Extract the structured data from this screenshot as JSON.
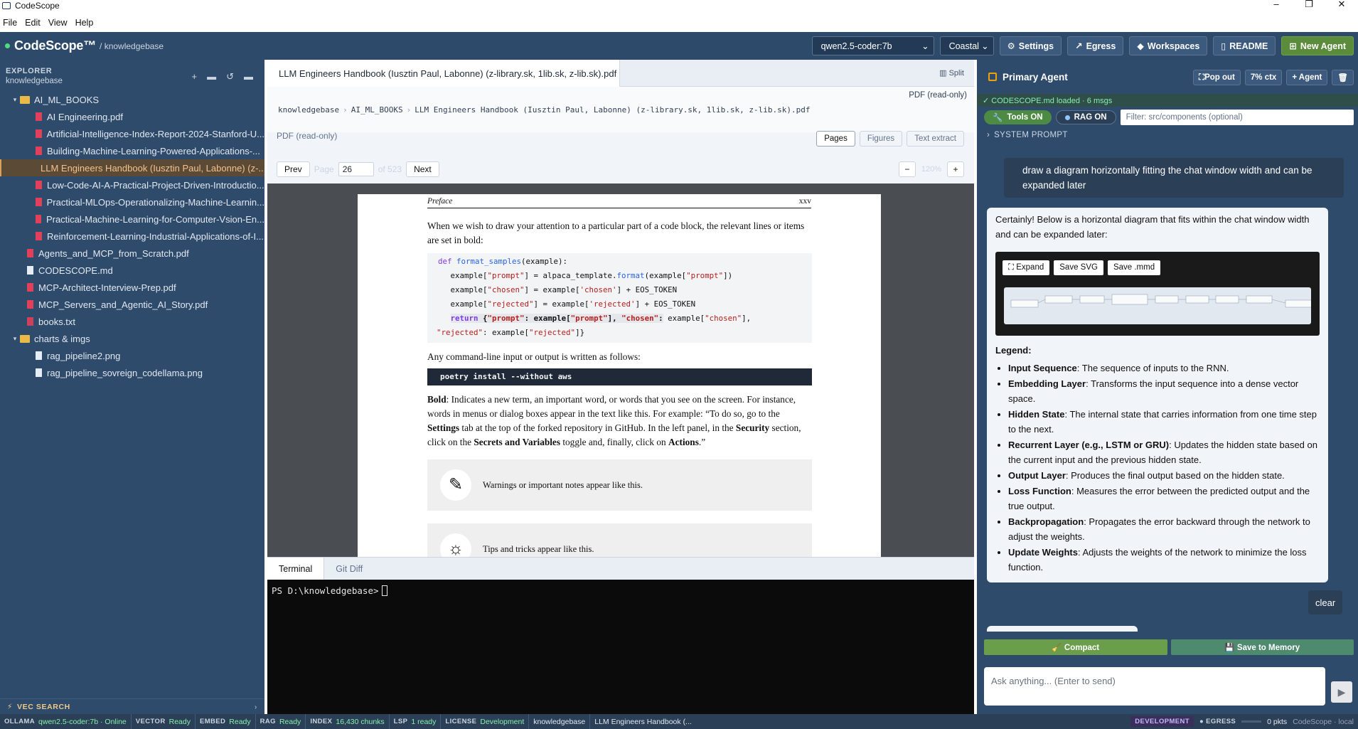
{
  "window": {
    "title": "CodeScope",
    "controls": [
      "–",
      "❐",
      "✕"
    ]
  },
  "menu": [
    "File",
    "Edit",
    "View",
    "Help"
  ],
  "header": {
    "brand": "CodeScope™",
    "path": "/ knowledgebase",
    "model_select": "qwen2.5-coder:7b",
    "theme_select": "Coastal",
    "buttons": {
      "settings": "Settings",
      "egress": "Egress",
      "workspaces": "Workspaces",
      "readme": "README",
      "new_agent": "New Agent"
    }
  },
  "sidebar": {
    "title": "EXPLORER",
    "subtitle": "knowledgebase",
    "items": [
      {
        "label": "AI_ML_BOOKS",
        "type": "folder",
        "level": 0,
        "twisty": "▾"
      },
      {
        "label": "AI Engineering.pdf",
        "type": "pdf",
        "level": 1
      },
      {
        "label": "Artificial-Intelligence-Index-Report-2024-Stanford-U...",
        "type": "pdf",
        "level": 1
      },
      {
        "label": "Building-Machine-Learning-Powered-Applications-...",
        "type": "pdf",
        "level": 1
      },
      {
        "label": "LLM Engineers Handbook (Iusztin Paul, Labonne) (z-...",
        "type": "pdf",
        "level": 1,
        "selected": true
      },
      {
        "label": "Low-Code-AI-A-Practical-Project-Driven-Introductio...",
        "type": "pdf",
        "level": 1
      },
      {
        "label": "Practical-MLOps-Operationalizing-Machine-Learnin...",
        "type": "pdf",
        "level": 1
      },
      {
        "label": "Practical-Machine-Learning-for-Computer-Vsion-En...",
        "type": "pdf",
        "level": 1
      },
      {
        "label": "Reinforcement-Learning-Industrial-Applications-of-I...",
        "type": "pdf",
        "level": 1
      },
      {
        "label": "Agents_and_MCP_from_Scratch.pdf",
        "type": "pdf",
        "level": 0
      },
      {
        "label": "CODESCOPE.md",
        "type": "md",
        "level": 0
      },
      {
        "label": "MCP-Architect-Interview-Prep.pdf",
        "type": "pdf",
        "level": 0
      },
      {
        "label": "MCP_Servers_and_Agentic_AI_Story.pdf",
        "type": "pdf",
        "level": 0
      },
      {
        "label": "books.txt",
        "type": "txt",
        "level": 0
      },
      {
        "label": "charts & imgs",
        "type": "folder",
        "level": 0,
        "twisty": "▾"
      },
      {
        "label": "rag_pipeline2.png",
        "type": "png",
        "level": 1
      },
      {
        "label": "rag_pipeline_sovreign_codellama.png",
        "type": "png",
        "level": 1
      }
    ],
    "vec_search": "VEC SEARCH"
  },
  "editor": {
    "tab_label": "LLM Engineers Handbook (Iusztin Paul, Labonne) (z-library.sk, 1lib.sk, z-lib.sk).pdf",
    "split_label": "Split",
    "readonly_tag": "PDF (read-only)",
    "breadcrumbs": [
      "knowledgebase",
      "AI_ML_BOOKS",
      "LLM Engineers Handbook (Iusztin Paul, Labonne) (z-library.sk, 1lib.sk, z-lib.sk).pdf"
    ],
    "readonly_label": "PDF (read-only)",
    "view_tabs": [
      "Pages",
      "Figures",
      "Text extract"
    ],
    "pager": {
      "prev": "Prev",
      "page_word": "Page",
      "page": "26",
      "of": "of 523",
      "next": "Next"
    },
    "zoom": {
      "minus": "−",
      "value": "120%",
      "plus": "+"
    },
    "page": {
      "running_head": "Preface",
      "page_num": "xxv",
      "para1": "When we wish to draw your attention to a particular part of a code block, the relevant lines or items are set in bold:",
      "para2": "Any command-line input or output is written as follows:",
      "command": "poetry install --without aws",
      "bold_word": "Bold",
      "para3": ": Indicates a new term, an important word, or words that you see on the screen. For instance, words in menus or dialog boxes appear in the text like this. For example: “To do so, go to the ",
      "settings_bold": "Settings",
      "para3b": " tab at the top of the forked repository in GitHub. In the left panel, in the ",
      "security_bold": "Security",
      "para3c": " section, click on the ",
      "secrets_bold": "Secrets and Variables",
      "para3d": " toggle and, finally, click on ",
      "actions_bold": "Actions",
      "para3e": ".”",
      "note_warning": "Warnings or important notes appear like this.",
      "note_tips": "Tips and tricks appear like this."
    },
    "terminal_tabs": [
      "Terminal",
      "Git Diff"
    ],
    "terminal_prompt": "PS D:\\knowledgebase>"
  },
  "agent": {
    "title": "Primary Agent",
    "buttons": {
      "popout": "Pop out",
      "ctx": "7% ctx",
      "add": "+ Agent",
      "delete": "🗑"
    },
    "loaded": "✓ CODESCOPE.md loaded · 6 msgs",
    "tools": "Tools ON",
    "rag": "RAG ON",
    "filter_placeholder": "Filter: src/components (optional)",
    "system_prompt": "SYSTEM PROMPT",
    "user_msg": "draw a diagram horizontally fitting the chat window width and can be expanded later",
    "bot_intro": "Certainly! Below is a horizontal diagram that fits within the chat window width and can be expanded later:",
    "diagram_buttons": {
      "expand": "⛶ Expand",
      "svg": "Save SVG",
      "mmd": "Save .mmd"
    },
    "legend_title": "Legend:",
    "legend": [
      {
        "term": "Input Sequence",
        "desc": ": The sequence of inputs to the RNN."
      },
      {
        "term": "Embedding Layer",
        "desc": ": Transforms the input sequence into a dense vector space."
      },
      {
        "term": "Hidden State",
        "desc": ": The internal state that carries information from one time step to the next."
      },
      {
        "term": "Recurrent Layer (e.g., LSTM or GRU)",
        "desc": ": Updates the hidden state based on the current input and the previous hidden state."
      },
      {
        "term": "Output Layer",
        "desc": ": Produces the final output based on the hidden state."
      },
      {
        "term": "Loss Function",
        "desc": ": Measures the error between the predicted output and the true output."
      },
      {
        "term": "Backpropagation",
        "desc": ": Propagates the error backward through the network to adjust the weights."
      },
      {
        "term": "Update Weights",
        "desc": ": Adjusts the weights of the network to minimize the loss function."
      }
    ],
    "user_msg2": "clear",
    "compact": "🧹 Compact",
    "save_memory": "💾 Save to Memory",
    "ask_placeholder": "Ask anything... (Enter to send)",
    "send": "▶"
  },
  "status": {
    "items": [
      {
        "key": "OLLAMA",
        "val": "qwen2.5-coder:7b · Online"
      },
      {
        "key": "VECTOR",
        "val": "Ready"
      },
      {
        "key": "EMBED",
        "val": "Ready"
      },
      {
        "key": "RAG",
        "val": "Ready"
      },
      {
        "key": "INDEX",
        "val": "16,430 chunks"
      },
      {
        "key": "LSP",
        "val": "1 ready"
      },
      {
        "key": "LICENSE",
        "val": "Development"
      }
    ],
    "workspace": "knowledgebase",
    "file": "LLM Engineers Handbook (...",
    "dev_badge": "DEVELOPMENT",
    "egress_label": "EGRESS",
    "egress_val": "0 pkts",
    "app": "CodeScope · local"
  },
  "colors": {
    "accent": "#2d4a6a",
    "selected_file": "#f5c28b",
    "ready": "#86efac"
  }
}
